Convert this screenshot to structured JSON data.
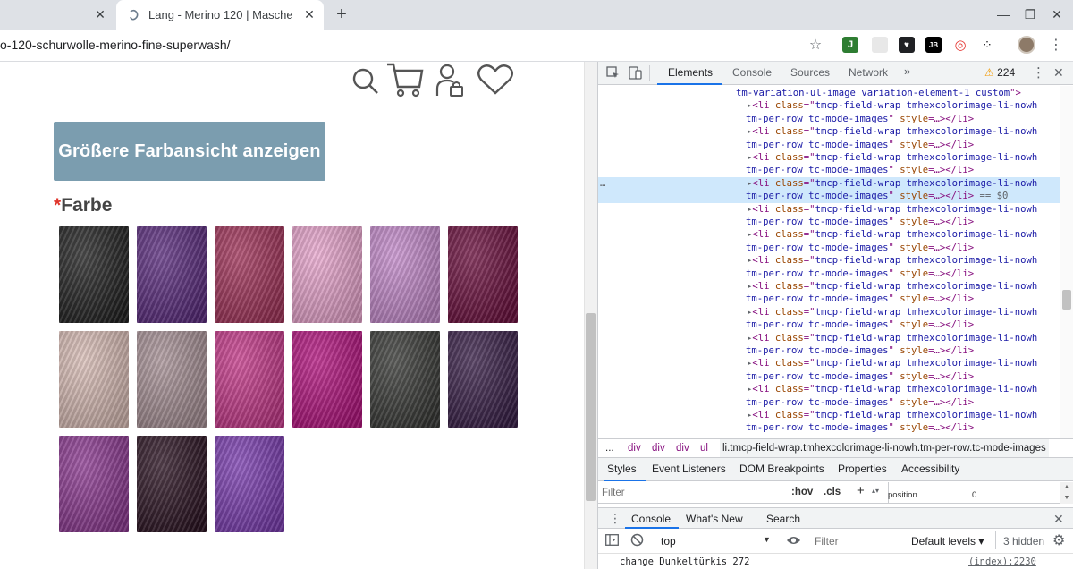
{
  "browser": {
    "tabs": [
      {
        "title": "",
        "active": false
      },
      {
        "title": "Lang - Merino 120 | Masche",
        "active": true
      }
    ],
    "url": "o-120-schurwolle-merino-fine-superwash/",
    "window_controls": {
      "minimize": "—",
      "maximize": "❐",
      "close": "✕"
    }
  },
  "page": {
    "header_icons": [
      "search-icon",
      "cart-icon",
      "account-icon",
      "wishlist-heart-icon"
    ],
    "button_label": "Größere Farbansicht anzeigen",
    "field_required_marker": "*",
    "field_label": "Farbe",
    "swatches": [
      {
        "name": "black",
        "color": "#232323"
      },
      {
        "name": "violet",
        "color": "#5b2d7e"
      },
      {
        "name": "raspberry",
        "color": "#a1345a"
      },
      {
        "name": "light-pink",
        "color": "#e8a5cd"
      },
      {
        "name": "lilac",
        "color": "#c48bcb"
      },
      {
        "name": "burgundy",
        "color": "#6d1240"
      },
      {
        "name": "blush",
        "color": "#d8bcb5"
      },
      {
        "name": "mauve-grey",
        "color": "#a79196"
      },
      {
        "name": "fuchsia",
        "color": "#c53a8a"
      },
      {
        "name": "magenta",
        "color": "#b3157f"
      },
      {
        "name": "charcoal",
        "color": "#3a3b38"
      },
      {
        "name": "aubergine",
        "color": "#3a2149"
      },
      {
        "name": "orchid",
        "color": "#8c3a91"
      },
      {
        "name": "dark-plum",
        "color": "#2d1524"
      },
      {
        "name": "purple",
        "color": "#7b3eb0"
      }
    ]
  },
  "devtools": {
    "toolbar_icons": [
      "inspect-element-icon",
      "device-toggle-icon"
    ],
    "tabs": [
      "Elements",
      "Console",
      "Sources",
      "Network",
      "»"
    ],
    "active_tab": "Elements",
    "issues_count": "224",
    "dom_lines": [
      {
        "text_parts": [
          [
            "tm-variation-ul-image variation-element-1 custom",
            "val"
          ],
          [
            "\">",
            "tag"
          ]
        ]
      },
      {
        "text_parts": [
          [
            "▸",
            "dim"
          ],
          [
            "<li ",
            "tag"
          ],
          [
            "class",
            "attr"
          ],
          [
            "=\"",
            "tag"
          ],
          [
            "tmcp-field-wrap tmhexcolorimage-li-nowh",
            "val"
          ]
        ]
      },
      {
        "text_parts": [
          [
            "tm-per-row tc-mode-images",
            "val"
          ],
          [
            "\" ",
            "tag"
          ],
          [
            "style",
            "attr"
          ],
          [
            "=…",
            "tag"
          ],
          [
            "></li>",
            "tag"
          ]
        ]
      },
      {
        "text_parts": [
          [
            "▸",
            "dim"
          ],
          [
            "<li ",
            "tag"
          ],
          [
            "class",
            "attr"
          ],
          [
            "=\"",
            "tag"
          ],
          [
            "tmcp-field-wrap tmhexcolorimage-li-nowh",
            "val"
          ]
        ]
      },
      {
        "text_parts": [
          [
            "tm-per-row tc-mode-images",
            "val"
          ],
          [
            "\" ",
            "tag"
          ],
          [
            "style",
            "attr"
          ],
          [
            "=…",
            "tag"
          ],
          [
            "></li>",
            "tag"
          ]
        ]
      },
      {
        "text_parts": [
          [
            "▸",
            "dim"
          ],
          [
            "<li ",
            "tag"
          ],
          [
            "class",
            "attr"
          ],
          [
            "=\"",
            "tag"
          ],
          [
            "tmcp-field-wrap tmhexcolorimage-li-nowh",
            "val"
          ]
        ]
      },
      {
        "text_parts": [
          [
            "tm-per-row tc-mode-images",
            "val"
          ],
          [
            "\" ",
            "tag"
          ],
          [
            "style",
            "attr"
          ],
          [
            "=…",
            "tag"
          ],
          [
            "></li>",
            "tag"
          ]
        ]
      },
      {
        "text_parts": [
          [
            "▸",
            "dim"
          ],
          [
            "<li ",
            "tag"
          ],
          [
            "class",
            "attr"
          ],
          [
            "=\"",
            "tag"
          ],
          [
            "tmcp-field-wrap tmhexcolorimage-li-nowh",
            "val"
          ]
        ],
        "selected": true,
        "dots": "…"
      },
      {
        "text_parts": [
          [
            "tm-per-row tc-mode-images",
            "val"
          ],
          [
            "\" ",
            "tag"
          ],
          [
            "style",
            "attr"
          ],
          [
            "=…",
            "tag"
          ],
          [
            "></li>",
            "tag"
          ],
          [
            " == $0",
            "dim"
          ]
        ],
        "selected": true
      },
      {
        "text_parts": [
          [
            "▸",
            "dim"
          ],
          [
            "<li ",
            "tag"
          ],
          [
            "class",
            "attr"
          ],
          [
            "=\"",
            "tag"
          ],
          [
            "tmcp-field-wrap tmhexcolorimage-li-nowh",
            "val"
          ]
        ]
      },
      {
        "text_parts": [
          [
            "tm-per-row tc-mode-images",
            "val"
          ],
          [
            "\" ",
            "tag"
          ],
          [
            "style",
            "attr"
          ],
          [
            "=…",
            "tag"
          ],
          [
            "></li>",
            "tag"
          ]
        ]
      },
      {
        "text_parts": [
          [
            "▸",
            "dim"
          ],
          [
            "<li ",
            "tag"
          ],
          [
            "class",
            "attr"
          ],
          [
            "=\"",
            "tag"
          ],
          [
            "tmcp-field-wrap tmhexcolorimage-li-nowh",
            "val"
          ]
        ]
      },
      {
        "text_parts": [
          [
            "tm-per-row tc-mode-images",
            "val"
          ],
          [
            "\" ",
            "tag"
          ],
          [
            "style",
            "attr"
          ],
          [
            "=…",
            "tag"
          ],
          [
            "></li>",
            "tag"
          ]
        ]
      },
      {
        "text_parts": [
          [
            "▸",
            "dim"
          ],
          [
            "<li ",
            "tag"
          ],
          [
            "class",
            "attr"
          ],
          [
            "=\"",
            "tag"
          ],
          [
            "tmcp-field-wrap tmhexcolorimage-li-nowh",
            "val"
          ]
        ]
      },
      {
        "text_parts": [
          [
            "tm-per-row tc-mode-images",
            "val"
          ],
          [
            "\" ",
            "tag"
          ],
          [
            "style",
            "attr"
          ],
          [
            "=…",
            "tag"
          ],
          [
            "></li>",
            "tag"
          ]
        ]
      },
      {
        "text_parts": [
          [
            "▸",
            "dim"
          ],
          [
            "<li ",
            "tag"
          ],
          [
            "class",
            "attr"
          ],
          [
            "=\"",
            "tag"
          ],
          [
            "tmcp-field-wrap tmhexcolorimage-li-nowh",
            "val"
          ]
        ]
      },
      {
        "text_parts": [
          [
            "tm-per-row tc-mode-images",
            "val"
          ],
          [
            "\" ",
            "tag"
          ],
          [
            "style",
            "attr"
          ],
          [
            "=…",
            "tag"
          ],
          [
            "></li>",
            "tag"
          ]
        ]
      },
      {
        "text_parts": [
          [
            "▸",
            "dim"
          ],
          [
            "<li ",
            "tag"
          ],
          [
            "class",
            "attr"
          ],
          [
            "=\"",
            "tag"
          ],
          [
            "tmcp-field-wrap tmhexcolorimage-li-nowh",
            "val"
          ]
        ]
      },
      {
        "text_parts": [
          [
            "tm-per-row tc-mode-images",
            "val"
          ],
          [
            "\" ",
            "tag"
          ],
          [
            "style",
            "attr"
          ],
          [
            "=…",
            "tag"
          ],
          [
            "></li>",
            "tag"
          ]
        ]
      },
      {
        "text_parts": [
          [
            "▸",
            "dim"
          ],
          [
            "<li ",
            "tag"
          ],
          [
            "class",
            "attr"
          ],
          [
            "=\"",
            "tag"
          ],
          [
            "tmcp-field-wrap tmhexcolorimage-li-nowh",
            "val"
          ]
        ]
      },
      {
        "text_parts": [
          [
            "tm-per-row tc-mode-images",
            "val"
          ],
          [
            "\" ",
            "tag"
          ],
          [
            "style",
            "attr"
          ],
          [
            "=…",
            "tag"
          ],
          [
            "></li>",
            "tag"
          ]
        ]
      },
      {
        "text_parts": [
          [
            "▸",
            "dim"
          ],
          [
            "<li ",
            "tag"
          ],
          [
            "class",
            "attr"
          ],
          [
            "=\"",
            "tag"
          ],
          [
            "tmcp-field-wrap tmhexcolorimage-li-nowh",
            "val"
          ]
        ]
      },
      {
        "text_parts": [
          [
            "tm-per-row tc-mode-images",
            "val"
          ],
          [
            "\" ",
            "tag"
          ],
          [
            "style",
            "attr"
          ],
          [
            "=…",
            "tag"
          ],
          [
            "></li>",
            "tag"
          ]
        ]
      },
      {
        "text_parts": [
          [
            "▸",
            "dim"
          ],
          [
            "<li ",
            "tag"
          ],
          [
            "class",
            "attr"
          ],
          [
            "=\"",
            "tag"
          ],
          [
            "tmcp-field-wrap tmhexcolorimage-li-nowh",
            "val"
          ]
        ]
      },
      {
        "text_parts": [
          [
            "tm-per-row tc-mode-images",
            "val"
          ],
          [
            "\" ",
            "tag"
          ],
          [
            "style",
            "attr"
          ],
          [
            "=…",
            "tag"
          ],
          [
            "></li>",
            "tag"
          ]
        ]
      },
      {
        "text_parts": [
          [
            "▸",
            "dim"
          ],
          [
            "<li ",
            "tag"
          ],
          [
            "class",
            "attr"
          ],
          [
            "=\"",
            "tag"
          ],
          [
            "tmcp-field-wrap tmhexcolorimage-li-nowh",
            "val"
          ]
        ]
      },
      {
        "text_parts": [
          [
            "tm-per-row tc-mode-images",
            "val"
          ],
          [
            "\" ",
            "tag"
          ],
          [
            "style",
            "attr"
          ],
          [
            "=…",
            "tag"
          ],
          [
            "></li>",
            "tag"
          ]
        ]
      }
    ],
    "breadcrumbs": [
      "...",
      "div",
      "div",
      "div",
      "ul",
      "li.tmcp-field-wrap.tmhexcolorimage-li-nowh.tm-per-row.tc-mode-images"
    ],
    "styles_tabs": [
      "Styles",
      "Event Listeners",
      "DOM Breakpoints",
      "Properties",
      "Accessibility"
    ],
    "filter_placeholder": "Filter",
    "hov_label": ":hov",
    "cls_label": ".cls",
    "add_label": "+",
    "box_model": {
      "label": "position",
      "value": "0"
    },
    "drawer_tabs": [
      "Console",
      "What's New",
      "Search"
    ],
    "console_context": "top",
    "console_filter_placeholder": "Filter",
    "log_levels": "Default levels ▾",
    "hidden_count": "3 hidden",
    "console_message": {
      "text": "change Dunkeltürkis 272",
      "source": "(index):2230"
    }
  }
}
